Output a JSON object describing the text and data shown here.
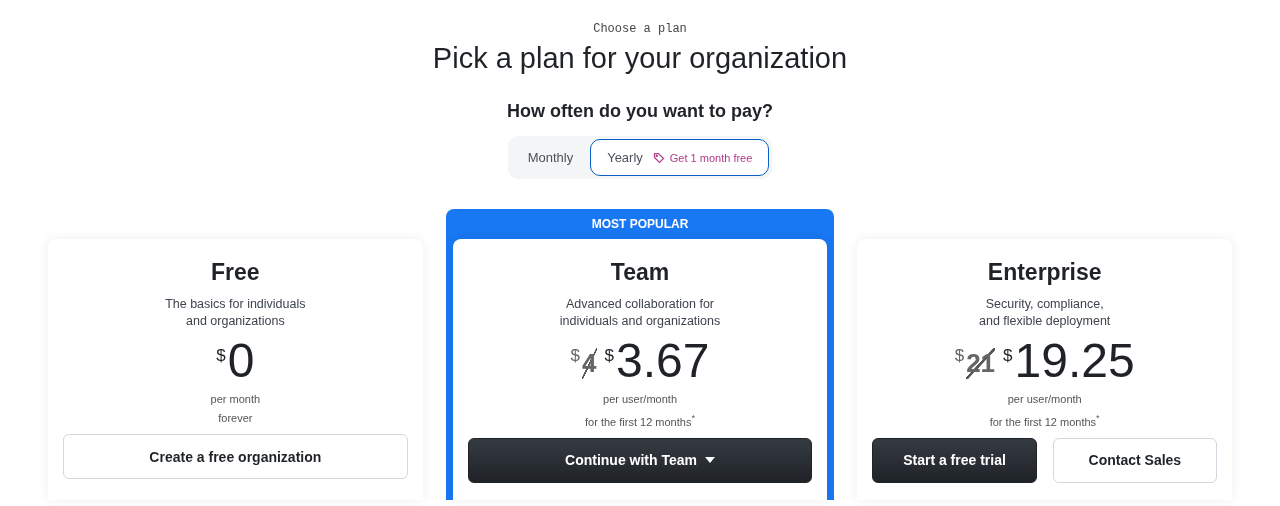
{
  "eyebrow": "Choose a plan",
  "title": "Pick a plan for your organization",
  "billing": {
    "question": "How often do you want to pay?",
    "options": [
      {
        "label": "Monthly",
        "selected": false
      },
      {
        "label": "Yearly",
        "selected": true,
        "badge": "Get 1 month free"
      }
    ]
  },
  "plans": [
    {
      "name": "Free",
      "highlighted": false,
      "description": [
        "The basics for individuals",
        "and organizations"
      ],
      "currency": "$",
      "price": "0",
      "notes": [
        "per month",
        "forever"
      ],
      "buttons": [
        {
          "label": "Create a free organization",
          "kind": "secondary",
          "caret": false
        }
      ]
    },
    {
      "name": "Team",
      "highlighted": true,
      "badge": "MOST POPULAR",
      "description": [
        "Advanced collaboration for",
        "individuals and organizations"
      ],
      "old_price": "4",
      "currency": "$",
      "price": "3.67",
      "notes": [
        "per user/month",
        "for the first 12 months$^{*}$"
      ],
      "buttons": [
        {
          "label": "Continue with Team",
          "kind": "primary",
          "caret": true
        }
      ]
    },
    {
      "name": "Enterprise",
      "highlighted": false,
      "description": [
        "Security, compliance,",
        "and flexible deployment"
      ],
      "old_price": "21",
      "currency": "$",
      "price": "19.25",
      "notes": [
        "per user/month",
        "for the first 12 months$^{*}$"
      ],
      "buttons": [
        {
          "label": "Start a free trial",
          "kind": "primary",
          "caret": false
        },
        {
          "label": "Contact Sales",
          "kind": "secondary",
          "caret": false
        }
      ]
    }
  ]
}
